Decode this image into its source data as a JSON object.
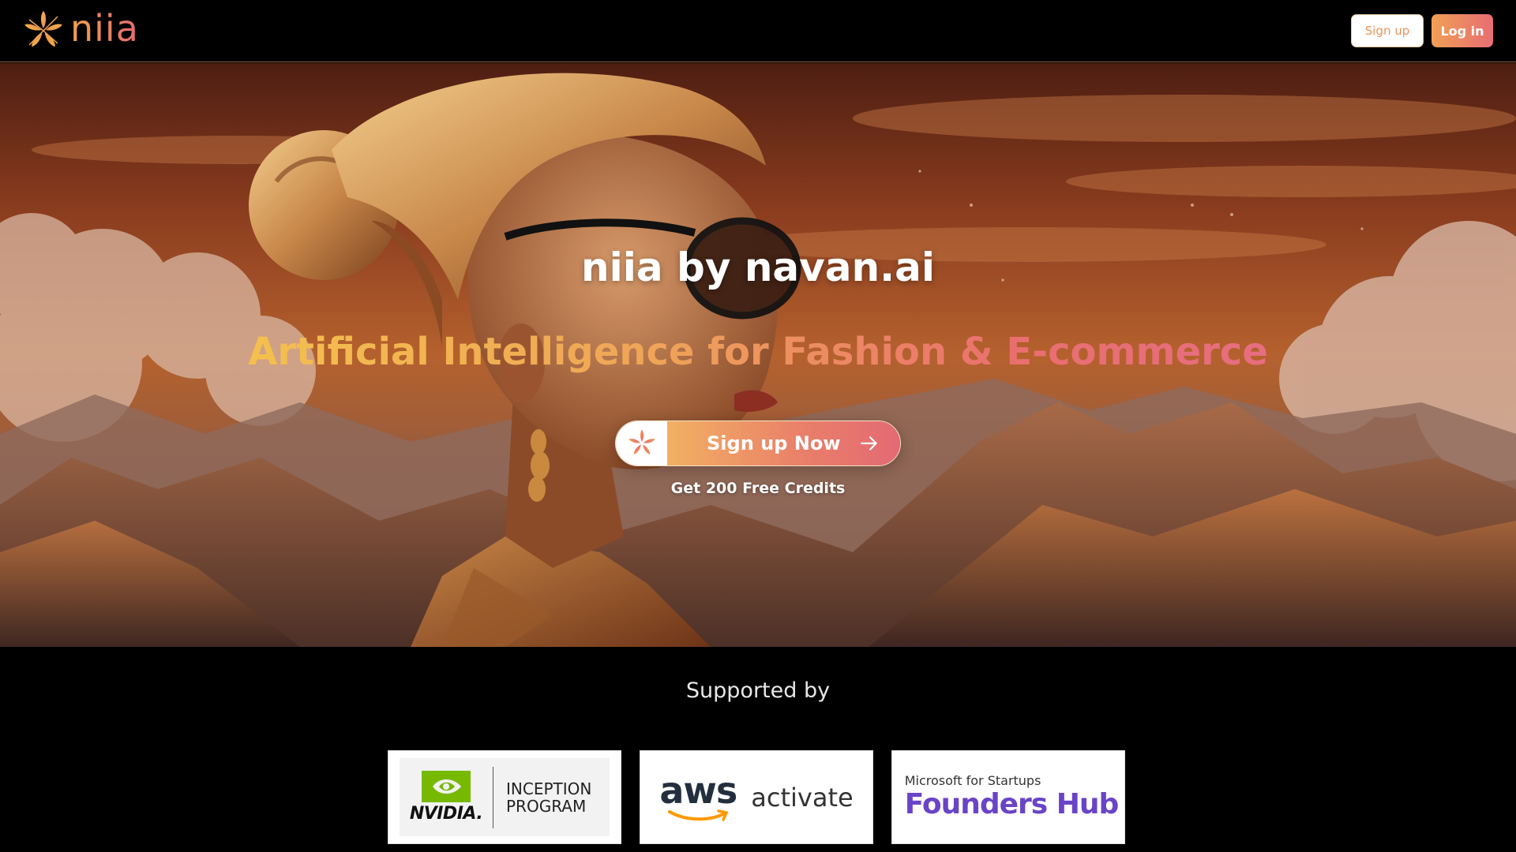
{
  "header": {
    "brand_name": "niia",
    "logo_icon": "flower-logo-icon",
    "signup_label": "Sign up",
    "login_label": "Log in"
  },
  "hero": {
    "background": "illustrated portrait of a woman with glasses in front of an orange sunset and mountains",
    "title": "niia by navan.ai",
    "tagline": "Artificial Intelligence for Fashion & E-commerce",
    "cta_label": "Sign up Now",
    "cta_icon": "flower-logo-icon",
    "cta_arrow_icon": "arrow-right-icon",
    "cta_sub": "Get 200 Free Credits"
  },
  "supported": {
    "title": "Supported by",
    "logos": {
      "nvidia": {
        "wordmark": "NVIDIA.",
        "line1": "INCEPTION",
        "line2": "PROGRAM"
      },
      "aws": {
        "wordmark": "aws",
        "text": "activate"
      },
      "microsoft": {
        "top": "Microsoft for Startups",
        "bottom": "Founders Hub"
      }
    }
  },
  "colors": {
    "accent_orange": "#f0a04b",
    "accent_pink": "#e56a72",
    "ms_purple": "#6a44c7"
  }
}
